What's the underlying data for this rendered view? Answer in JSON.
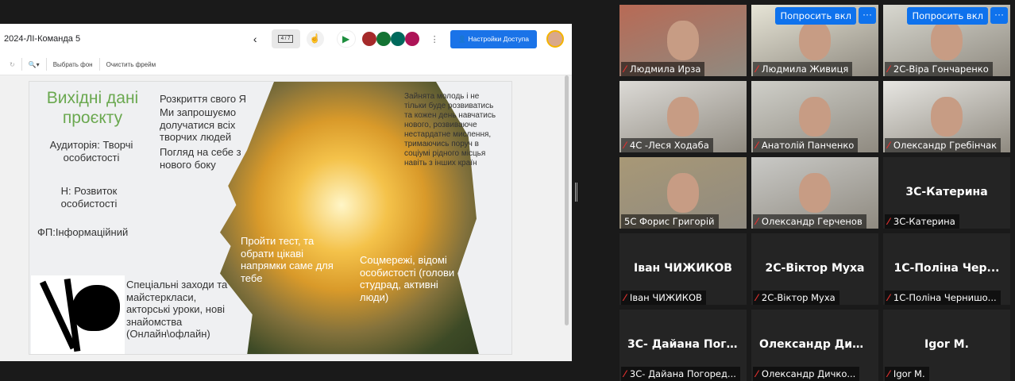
{
  "doc": {
    "title": "2024-ЛІ-Команда 5",
    "page_indicator": "4 / 7",
    "share_button": "Настройки Доступа"
  },
  "toolbar": {
    "choose_bg": "Выбрать фон",
    "clear_frame": "Очистить фрейм"
  },
  "slide": {
    "title": "Вихідні дані проєкту",
    "audience": "Аудиторія: Творчі особистості",
    "need": "Н: Розвиток особистості",
    "fp": "ФП:Інформаційний",
    "self": "Розкриття свого Я",
    "invite": "Ми запрошуємо долучатися всіх творчих людей",
    "view": "Погляд на себе з нового боку",
    "youth": "Зайнята молодь і не тільки буде розвиватись та кожен день навчатись нового, розвиваюче нестардатне мислення, тримаючись поруч в соціумі рідного місцья навіть з інших країн",
    "test": "Пройти тест, та обрати цікаві напрямки саме для тебе",
    "social": "Соцмережі,  відомі особистості  (голови студрад, активні люди)",
    "events": "Спеціальні заходи та майстеркласи, акторські уроки, нові знайомства (Онлайн\\офлайн)"
  },
  "participants": [
    {
      "name": "Людмила Ирза",
      "video": true
    },
    {
      "name": "Людмила Живиця",
      "video": true,
      "ask": "Попросить вкл"
    },
    {
      "name": "2С-Віра Гончаренко",
      "video": true,
      "ask": "Попросить вкл"
    },
    {
      "name": "4С -Леся Ходаба",
      "video": true
    },
    {
      "name": "Анатолій Панченко",
      "video": true
    },
    {
      "name": "Олександр Гребінчак",
      "video": true
    },
    {
      "name": "5С Форис Григорій",
      "video": true
    },
    {
      "name": "Олександр Герченов",
      "video": true
    },
    {
      "name": "3С-Катерина",
      "display": "3С-Катерина"
    },
    {
      "name": "Іван ЧИЖИКОВ",
      "display": "Іван ЧИЖИКОВ"
    },
    {
      "name": "2С-Віктор Муха",
      "display": "2С-Віктор Муха"
    },
    {
      "name": "1С-Поліна Чернишо...",
      "display": "1С-Поліна Чер..."
    },
    {
      "name": "3С- Дайана Погоред...",
      "display": "3С- Дайана Пог..."
    },
    {
      "name": "Олександр Дичко...",
      "display": "Олександр Дич..."
    },
    {
      "name": "Igor M.",
      "display": "Igor M."
    }
  ],
  "more_label": "···"
}
